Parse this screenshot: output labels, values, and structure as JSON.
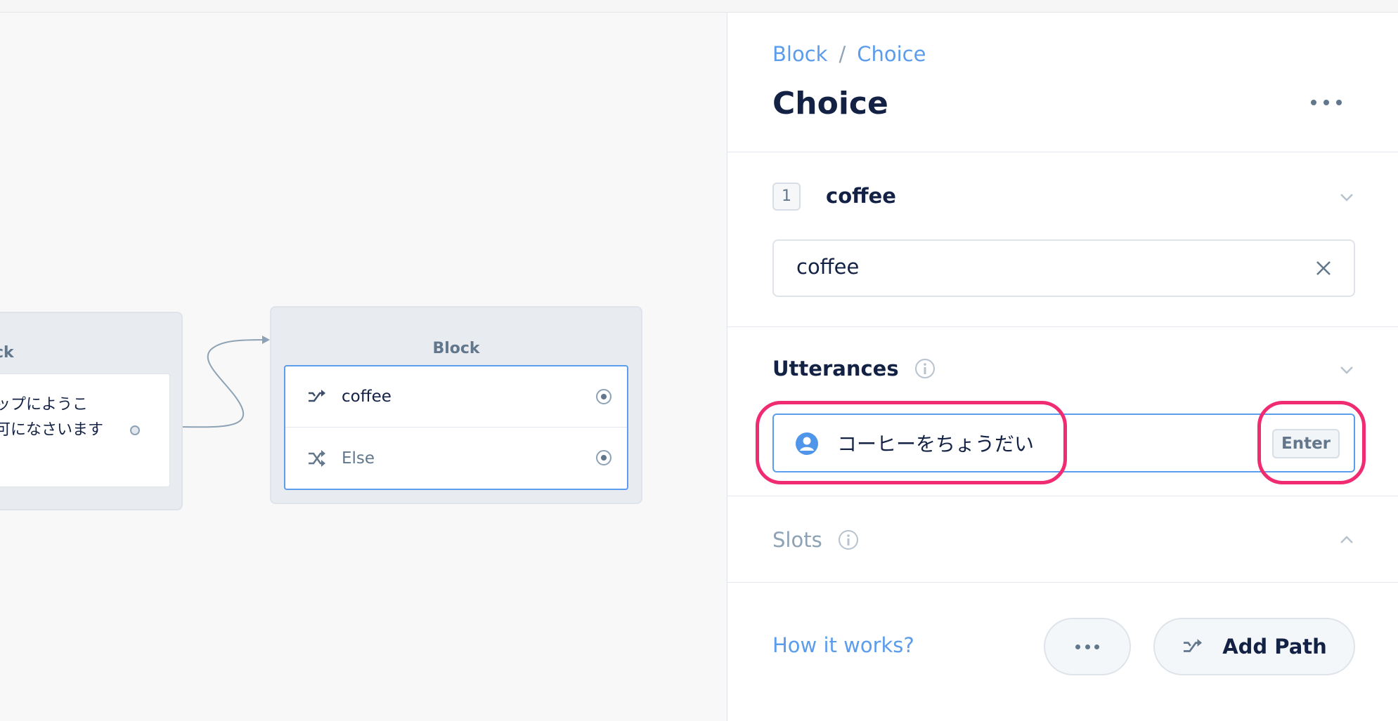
{
  "canvas": {
    "left_block": {
      "title": "ck",
      "message": "ップにようこ\n可になさいます"
    },
    "right_block": {
      "title": "Block",
      "steps": [
        {
          "label": "coffee",
          "icon": "shuffle-icon"
        },
        {
          "label": "Else",
          "icon": "shuffle-cross-icon"
        }
      ]
    }
  },
  "panel": {
    "breadcrumb": {
      "parent": "Block",
      "separator": "/",
      "current": "Choice"
    },
    "title": "Choice",
    "path": {
      "number": "1",
      "name": "coffee",
      "value": "coffee"
    },
    "utterances": {
      "title": "Utterances",
      "input_value": "コーヒーをちょうだい",
      "enter_label": "Enter"
    },
    "slots": {
      "title": "Slots"
    },
    "footer": {
      "help_link": "How it works?",
      "add_path_label": "Add Path"
    }
  },
  "colors": {
    "accent": "#5b9ced",
    "highlight": "#f02b71",
    "text": "#132144",
    "muted": "#62778c"
  }
}
